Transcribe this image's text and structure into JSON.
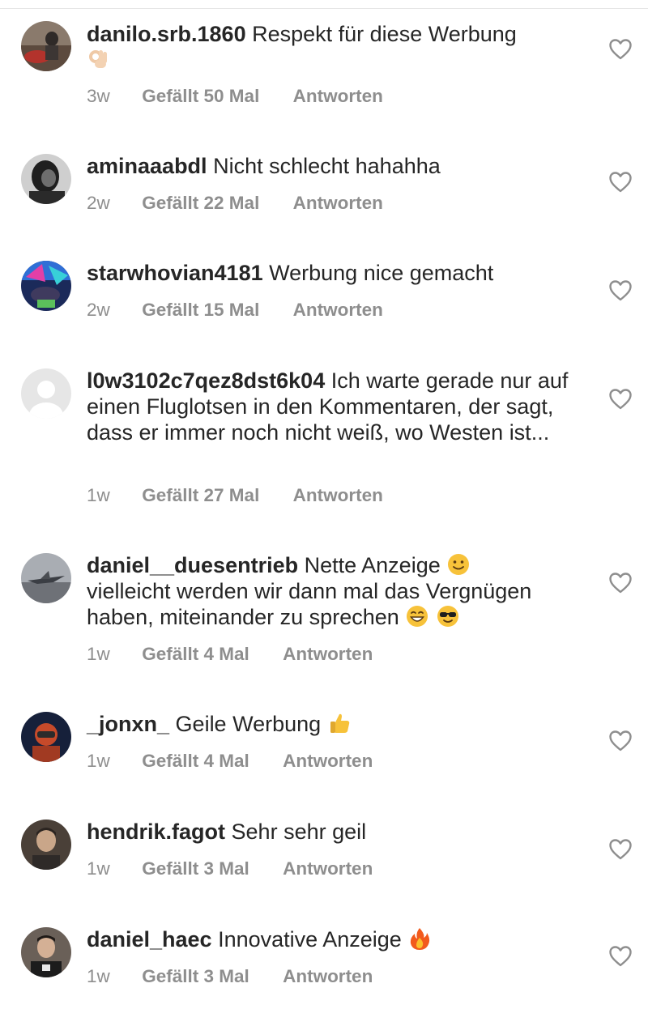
{
  "comments": [
    {
      "username": "danilo.srb.1860",
      "text": "Respekt für diese Werbung",
      "time": "3w",
      "likes": "Gefällt 50 Mal",
      "reply": "Antworten"
    },
    {
      "username": "aminaaabdl",
      "text": "Nicht schlecht hahahha",
      "time": "2w",
      "likes": "Gefällt 22 Mal",
      "reply": "Antworten"
    },
    {
      "username": "starwhovian4181",
      "text": "Werbung nice gemacht",
      "time": "2w",
      "likes": "Gefällt 15 Mal",
      "reply": "Antworten"
    },
    {
      "username": "l0w3102c7qez8dst6k04",
      "text": "Ich warte gerade nur auf einen Fluglotsen in den Kommentaren, der sagt, dass er immer noch nicht weiß, wo Westen ist...",
      "time": "1w",
      "likes": "Gefällt 27 Mal",
      "reply": "Antworten"
    },
    {
      "username": "daniel__duesentrieb",
      "text": "Nette Anzeige",
      "text2": "vielleicht werden wir dann mal das Vergnügen haben, miteinander zu sprechen",
      "time": "1w",
      "likes": "Gefällt 4 Mal",
      "reply": "Antworten"
    },
    {
      "username": "_jonxn_",
      "text": "Geile Werbung",
      "time": "1w",
      "likes": "Gefällt 4 Mal",
      "reply": "Antworten"
    },
    {
      "username": "hendrik.fagot",
      "text": "Sehr sehr geil",
      "time": "1w",
      "likes": "Gefällt 3 Mal",
      "reply": "Antworten"
    },
    {
      "username": "daniel_haec",
      "text": "Innovative Anzeige",
      "time": "1w",
      "likes": "Gefällt 3 Mal",
      "reply": "Antworten"
    }
  ],
  "icons": {
    "heart": "heart-outline-icon",
    "emojis": [
      "ok-hand-emoji",
      "slightly-smiling-face-emoji",
      "grinning-face-emoji",
      "sunglasses-face-emoji",
      "thumbs-up-emoji",
      "fire-emoji"
    ]
  },
  "colors": {
    "text": "#262626",
    "meta": "#8e8e8e",
    "heart_stroke": "#8e8e8e"
  }
}
